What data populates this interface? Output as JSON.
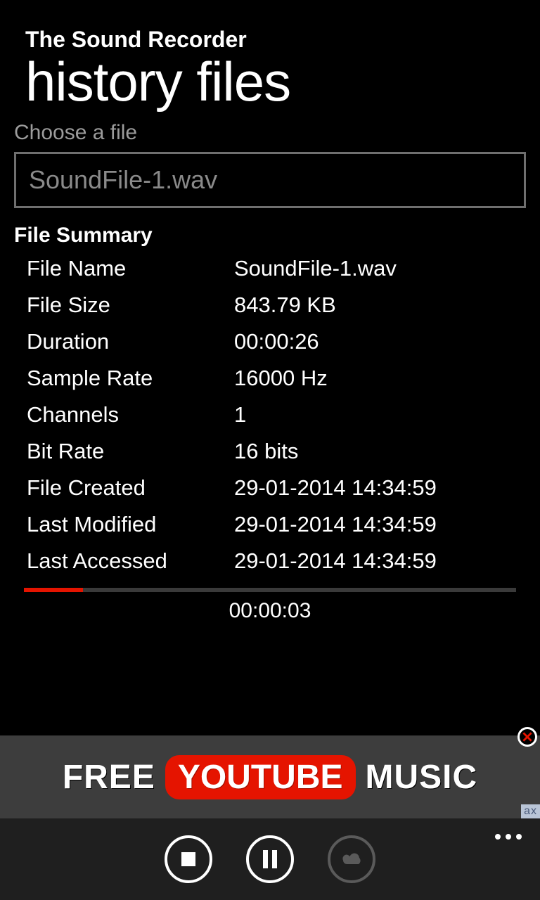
{
  "header": {
    "app_title": "The Sound Recorder",
    "page_title": "history files"
  },
  "file_picker": {
    "label": "Choose a file",
    "selected": "SoundFile-1.wav"
  },
  "summary": {
    "title": "File Summary",
    "rows": [
      {
        "label": "File Name",
        "value": "SoundFile-1.wav"
      },
      {
        "label": "File Size",
        "value": "843.79 KB"
      },
      {
        "label": "Duration",
        "value": "00:00:26"
      },
      {
        "label": "Sample Rate",
        "value": "16000 Hz"
      },
      {
        "label": "Channels",
        "value": "1"
      },
      {
        "label": "Bit Rate",
        "value": "16 bits"
      },
      {
        "label": "File Created",
        "value": "29-01-2014 14:34:59"
      },
      {
        "label": "Last Modified",
        "value": "29-01-2014 14:34:59"
      },
      {
        "label": "Last Accessed",
        "value": "29-01-2014 14:34:59"
      }
    ]
  },
  "player": {
    "elapsed": "00:00:03",
    "progress_percent": 12
  },
  "ad": {
    "word1": "FREE",
    "word2": "YOUTUBE",
    "word3": "MUSIC",
    "badge": "ax"
  }
}
